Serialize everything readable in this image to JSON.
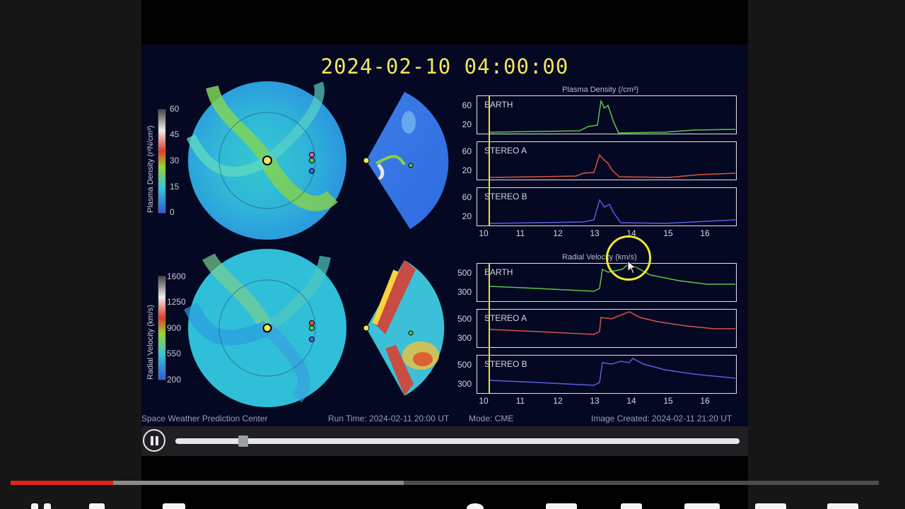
{
  "video": {
    "timestamp": "2024-02-10  04:00:00",
    "footer": {
      "org": "Space Weather Prediction Center",
      "run_time": "Run Time: 2024-02-11 20:00 UT",
      "mode": "Mode: CME",
      "image_created": "Image Created: 2024-02-11 21:20 UT"
    },
    "density_colorbar": {
      "label": "Plasma Density (r²N/cm³)",
      "ticks": [
        "60",
        "45",
        "30",
        "15",
        "0"
      ]
    },
    "velocity_colorbar": {
      "label": "Radial Velocity (km/s)",
      "ticks": [
        "1600",
        "1250",
        "900",
        "550",
        "200"
      ]
    },
    "density_panel": {
      "title": "Plasma Density (/cm³)",
      "plots": [
        {
          "name": "EARTH",
          "yticks": [
            "60",
            "20"
          ]
        },
        {
          "name": "STEREO A",
          "yticks": [
            "60",
            "20"
          ]
        },
        {
          "name": "STEREO B",
          "yticks": [
            "60",
            "20"
          ]
        }
      ],
      "xticks": [
        "10",
        "11",
        "12",
        "13",
        "14",
        "15",
        "16"
      ]
    },
    "velocity_panel": {
      "title": "Radial Velocity (km/s)",
      "plots": [
        {
          "name": "EARTH",
          "yticks": [
            "500",
            "300"
          ]
        },
        {
          "name": "STEREO A",
          "yticks": [
            "500",
            "300"
          ]
        },
        {
          "name": "STEREO B",
          "yticks": [
            "500",
            "300"
          ]
        }
      ],
      "xticks": [
        "10",
        "11",
        "12",
        "13",
        "14",
        "15",
        "16"
      ]
    }
  },
  "player": {
    "state": "playing",
    "progress_fraction": 0.12,
    "youtube_progress_fraction": 0.118,
    "youtube_buffer_fraction": 0.453
  },
  "colors": {
    "timestamp": "#f3e65c",
    "earth": "#5fc44a",
    "stereo_a": "#d8554a",
    "stereo_b": "#5a5ee0",
    "marker": "#e6e23b",
    "youtube_red": "#e1251b"
  }
}
